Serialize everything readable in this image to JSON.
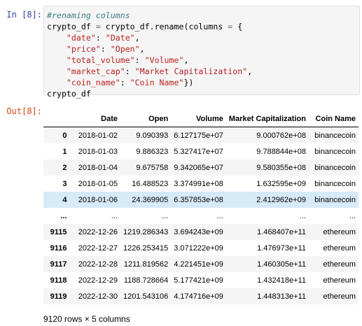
{
  "input_prompt": "In [8]:",
  "output_prompt": "Out[8]:",
  "code": {
    "comment": "#renaming columns",
    "assign_target": "crypto_df",
    "assign_op": "=",
    "call": "crypto_df.rename(columns",
    "kw_op": "=",
    "open_brace": "{",
    "mappings": [
      {
        "from": "\"date\"",
        "to": "\"Date\""
      },
      {
        "from": "\"price\"",
        "to": "\"Open\""
      },
      {
        "from": "\"total_volume\"",
        "to": "\"Volume\""
      },
      {
        "from": "\"market_cap\"",
        "to": "\"Market Capitalization\""
      },
      {
        "from": "\"coin_name\"",
        "to": "\"Coin Name\""
      }
    ],
    "close": "})",
    "last_line": "crypto_df"
  },
  "dataframe": {
    "columns": [
      "",
      "Date",
      "Open",
      "Volume",
      "Market Capitalization",
      "Coin Name"
    ],
    "rows": [
      {
        "index": "0",
        "date": "2018-01-02",
        "open": "9.090393",
        "volume": "6.127175e+07",
        "mcap": "9.000762e+08",
        "coin": "binancecoin",
        "hovered": false
      },
      {
        "index": "1",
        "date": "2018-01-03",
        "open": "9.886323",
        "volume": "5.327417e+07",
        "mcap": "9.788844e+08",
        "coin": "binancecoin",
        "hovered": false
      },
      {
        "index": "2",
        "date": "2018-01-04",
        "open": "9.675758",
        "volume": "9.342065e+07",
        "mcap": "9.580355e+08",
        "coin": "binancecoin",
        "hovered": false
      },
      {
        "index": "3",
        "date": "2018-01-05",
        "open": "16.488523",
        "volume": "3.374991e+08",
        "mcap": "1.632595e+09",
        "coin": "binancecoin",
        "hovered": false
      },
      {
        "index": "4",
        "date": "2018-01-06",
        "open": "24.369905",
        "volume": "6.357853e+08",
        "mcap": "2.412962e+09",
        "coin": "binancecoin",
        "hovered": true
      },
      {
        "index": "...",
        "date": "...",
        "open": "...",
        "volume": "...",
        "mcap": "...",
        "coin": "...",
        "hovered": false
      },
      {
        "index": "9115",
        "date": "2022-12-26",
        "open": "1219.286343",
        "volume": "3.694243e+09",
        "mcap": "1.468407e+11",
        "coin": "ethereum",
        "hovered": false
      },
      {
        "index": "9116",
        "date": "2022-12-27",
        "open": "1226.253415",
        "volume": "3.071222e+09",
        "mcap": "1.476973e+11",
        "coin": "ethereum",
        "hovered": false
      },
      {
        "index": "9117",
        "date": "2022-12-28",
        "open": "1211.819562",
        "volume": "4.221451e+09",
        "mcap": "1.460305e+11",
        "coin": "ethereum",
        "hovered": false
      },
      {
        "index": "9118",
        "date": "2022-12-29",
        "open": "1188.728664",
        "volume": "5.177421e+09",
        "mcap": "1.432418e+11",
        "coin": "ethereum",
        "hovered": false
      },
      {
        "index": "9119",
        "date": "2022-12-30",
        "open": "1201.543106",
        "volume": "4.174716e+09",
        "mcap": "1.448313e+11",
        "coin": "ethereum",
        "hovered": false
      }
    ],
    "shape_text": "9120 rows × 5 columns"
  },
  "colors": {
    "input_prompt": "#303f9f",
    "output_prompt": "#d84315",
    "code_background": "#f5f5f5",
    "string": "#ba2121",
    "comment": "#408080",
    "row_hover": "#d6eaf8"
  }
}
